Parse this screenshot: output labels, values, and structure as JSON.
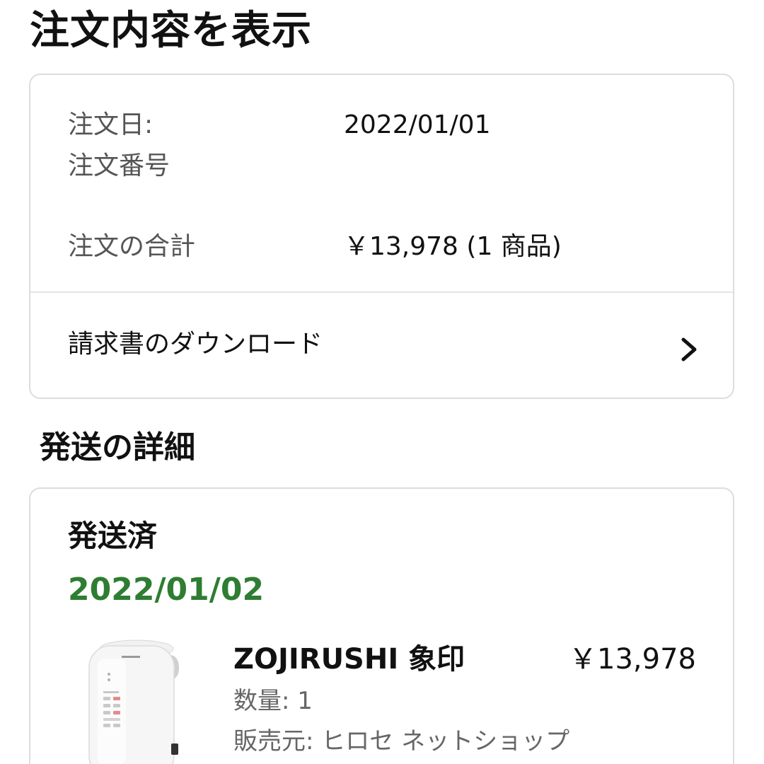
{
  "header": {
    "title": "注文内容を表示"
  },
  "summary": {
    "order_date_label": "注文日:",
    "order_date_value": "2022/01/01",
    "order_number_label": "注文番号",
    "order_number_value": "",
    "order_total_label": "注文の合計",
    "order_total_value": "￥13,978 (1 商品)",
    "invoice_label": "請求書のダウンロード",
    "invoice_icon": "chevron-right-icon"
  },
  "shipping": {
    "section_title": "発送の詳細",
    "status": "発送済",
    "date": "2022/01/02",
    "date_color": "#2e7d32",
    "item": {
      "name": "ZOJIRUSHI 象印",
      "price": "￥13,978",
      "quantity": "数量: 1",
      "seller": "販売元: ヒロセ ネットショップ",
      "image_icon": "humidifier-product-image"
    }
  }
}
